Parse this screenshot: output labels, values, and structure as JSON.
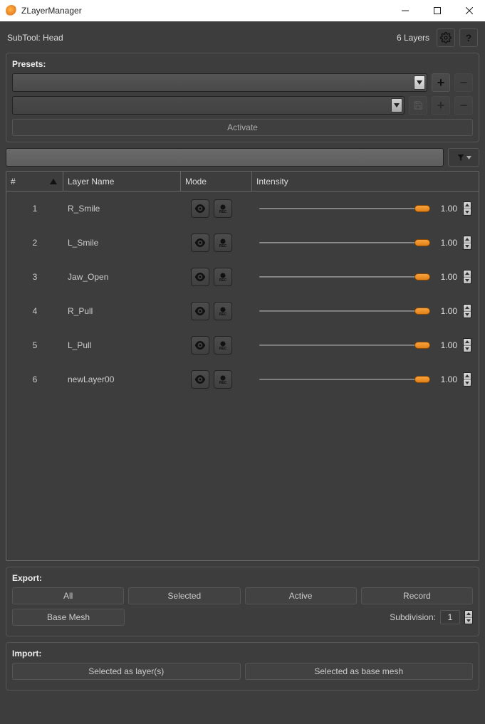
{
  "window": {
    "title": "ZLayerManager"
  },
  "header": {
    "subtool_prefix": "SubTool:",
    "subtool_name": "Head",
    "layer_count": "6  Layers"
  },
  "presets": {
    "title": "Presets:",
    "activate_label": "Activate"
  },
  "columns": {
    "num": "#",
    "name": "Layer Name",
    "mode": "Mode",
    "intensity": "Intensity"
  },
  "layers": [
    {
      "num": "1",
      "name": "R_Smile",
      "intensity": "1.00"
    },
    {
      "num": "2",
      "name": "L_Smile",
      "intensity": "1.00"
    },
    {
      "num": "3",
      "name": "Jaw_Open",
      "intensity": "1.00"
    },
    {
      "num": "4",
      "name": "R_Pull",
      "intensity": "1.00"
    },
    {
      "num": "5",
      "name": "L_Pull",
      "intensity": "1.00"
    },
    {
      "num": "6",
      "name": "newLayer00",
      "intensity": "1.00"
    }
  ],
  "export": {
    "title": "Export:",
    "all": "All",
    "selected": "Selected",
    "active": "Active",
    "record": "Record",
    "basemesh": "Base Mesh",
    "subdivision_label": "Subdivision:",
    "subdivision_value": "1"
  },
  "import": {
    "title": "Import:",
    "as_layers": "Selected as layer(s)",
    "as_basemesh": "Selected as base mesh"
  }
}
